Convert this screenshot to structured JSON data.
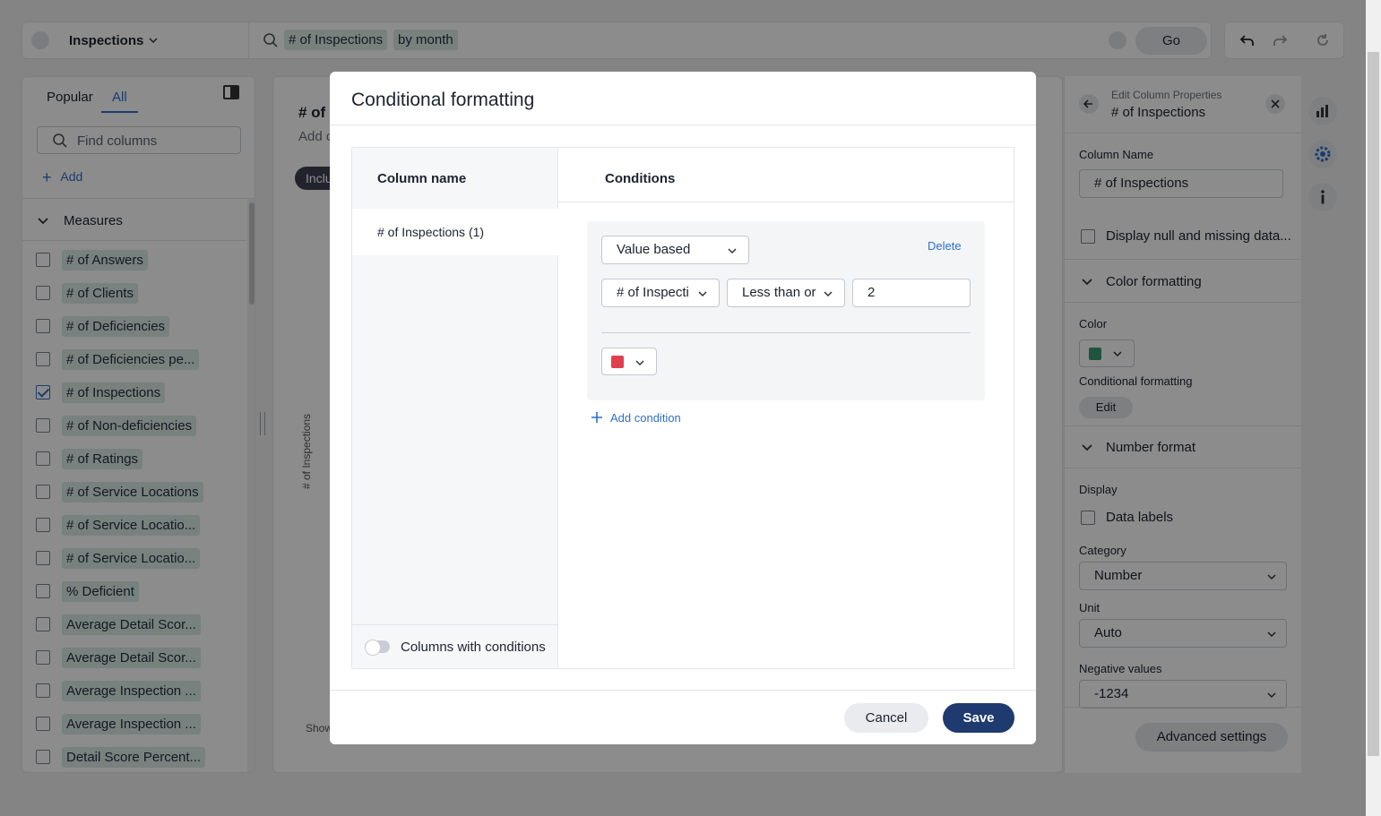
{
  "colors": {
    "accent": "#2f6fc9",
    "save_button": "#1e3a6f",
    "condition_color": "#e0404e",
    "column_color": "#3a9a74",
    "chip_bg": "#d9ece5"
  },
  "topbar": {
    "datasource": "Inspections",
    "search_tokens": [
      "# of Inspections",
      "by month"
    ],
    "go_label": "Go"
  },
  "left_panel": {
    "tabs": {
      "popular": "Popular",
      "all": "All"
    },
    "find_placeholder": "Find columns",
    "add_label": "Add",
    "measures_label": "Measures",
    "measures": [
      {
        "label": "# of Answers",
        "checked": false
      },
      {
        "label": "# of Clients",
        "checked": false
      },
      {
        "label": "# of Deficiencies",
        "checked": false
      },
      {
        "label": "# of Deficiencies pe...",
        "checked": false
      },
      {
        "label": "# of Inspections",
        "checked": true
      },
      {
        "label": "# of Non-deficiencies",
        "checked": false
      },
      {
        "label": "# of Ratings",
        "checked": false
      },
      {
        "label": "# of Service Locations",
        "checked": false
      },
      {
        "label": "# of Service Locatio...",
        "checked": false
      },
      {
        "label": "# of Service Locatio...",
        "checked": false
      },
      {
        "label": "% Deficient",
        "checked": false
      },
      {
        "label": "Average Detail Scor...",
        "checked": false
      },
      {
        "label": "Average Detail Scor...",
        "checked": false
      },
      {
        "label": "Average Inspection ...",
        "checked": false
      },
      {
        "label": "Average Inspection ...",
        "checked": false
      },
      {
        "label": "Detail Score Percent...",
        "checked": false
      }
    ]
  },
  "center": {
    "title": "# of",
    "subtitle": "Add c",
    "pill": "Inclu",
    "y_axis_label": "# of Inspections",
    "show_label": "Show"
  },
  "right_panel": {
    "subtitle": "Edit Column Properties",
    "title": "# of Inspections",
    "column_name_label": "Column Name",
    "column_name_value": "# of Inspections",
    "display_null_label": "Display null and missing data...",
    "color_formatting_label": "Color formatting",
    "color_label": "Color",
    "conditional_formatting_label": "Conditional formatting",
    "edit_label": "Edit",
    "number_format_label": "Number format",
    "display_label": "Display",
    "data_labels_label": "Data labels",
    "category_label": "Category",
    "category_value": "Number",
    "unit_label": "Unit",
    "unit_value": "Auto",
    "negative_values_label": "Negative values",
    "negative_values_value": "-1234",
    "advanced_settings_label": "Advanced settings"
  },
  "modal": {
    "title": "Conditional formatting",
    "column_name_header": "Column name",
    "conditions_header": "Conditions",
    "column_item": "# of Inspections (1)",
    "columns_with_conditions_label": "Columns with conditions",
    "condition": {
      "type": "Value based",
      "delete_label": "Delete",
      "column": "# of Inspecti",
      "operator": "Less than or",
      "value": "2"
    },
    "add_condition_label": "Add condition",
    "cancel_label": "Cancel",
    "save_label": "Save"
  }
}
